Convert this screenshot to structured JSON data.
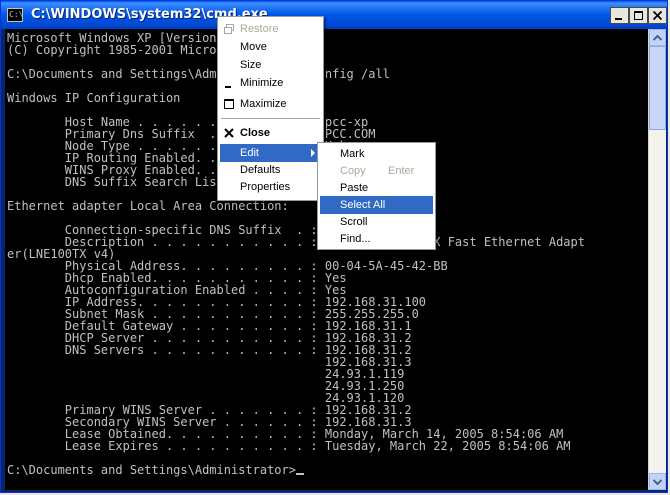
{
  "window": {
    "title": "C:\\WINDOWS\\system32\\cmd.exe",
    "icon_text": "C:\\"
  },
  "console": {
    "lines": [
      "Microsoft Windows XP [Version 5.1.2600]",
      "(C) Copyright 1985-2001 Microsoft Corp.",
      "",
      "C:\\Documents and Settings\\Administrator>ipconfig /all",
      "",
      "Windows IP Configuration",
      "",
      "        Host Name . . . . . . . . . . . . : pcc-xp",
      "        Primary Dns Suffix  . . . . . . . : PCC.COM",
      "        Node Type . . . . . . . . . . . . : Unknown",
      "        IP Routing Enabled. . . . . . . . : No",
      "        WINS Proxy Enabled. . . . . . . . : No",
      "        DNS Suffix Search List. . . . . . : PCC.COM",
      "",
      "Ethernet adapter Local Area Connection:",
      "",
      "        Connection-specific DNS Suffix  . :",
      "        Description . . . . . . . . . . . : Linksys LNE100TX Fast Ethernet Adapt",
      "er(LNE100TX v4)",
      "        Physical Address. . . . . . . . . : 00-04-5A-45-42-BB",
      "        Dhcp Enabled. . . . . . . . . . . : Yes",
      "        Autoconfiguration Enabled . . . . : Yes",
      "        IP Address. . . . . . . . . . . . : 192.168.31.100",
      "        Subnet Mask . . . . . . . . . . . : 255.255.255.0",
      "        Default Gateway . . . . . . . . . : 192.168.31.1",
      "        DHCP Server . . . . . . . . . . . : 192.168.31.2",
      "        DNS Servers . . . . . . . . . . . : 192.168.31.2",
      "                                            192.168.31.3",
      "                                            24.93.1.119",
      "                                            24.93.1.250",
      "                                            24.93.1.120",
      "        Primary WINS Server . . . . . . . : 192.168.31.2",
      "        Secondary WINS Server . . . . . . : 192.168.31.3",
      "        Lease Obtained. . . . . . . . . . : Monday, March 14, 2005 8:54:06 AM",
      "        Lease Expires . . . . . . . . . . : Tuesday, March 22, 2005 8:54:06 AM",
      "",
      "C:\\Documents and Settings\\Administrator>"
    ]
  },
  "system_menu": {
    "restore": "Restore",
    "move": "Move",
    "size": "Size",
    "minimize": "Minimize",
    "maximize": "Maximize",
    "close": "Close",
    "edit": "Edit",
    "defaults": "Defaults",
    "properties": "Properties"
  },
  "edit_menu": {
    "mark": "Mark",
    "copy": "Copy",
    "copy_shortcut": "Enter",
    "paste": "Paste",
    "select_all": "Select All",
    "scroll": "Scroll",
    "find": "Find..."
  },
  "colors": {
    "console_bg": "#000000",
    "console_fg": "#c0c0c0",
    "menu_highlight": "#316ac5",
    "titlebar": "#0055e5"
  },
  "icons": [
    "console-app-icon",
    "minimize-icon",
    "maximize-icon",
    "close-icon",
    "scroll-up-icon",
    "scroll-down-icon",
    "restore-icon",
    "minimize-menu-icon",
    "maximize-menu-icon",
    "close-menu-icon",
    "submenu-arrow-icon"
  ]
}
